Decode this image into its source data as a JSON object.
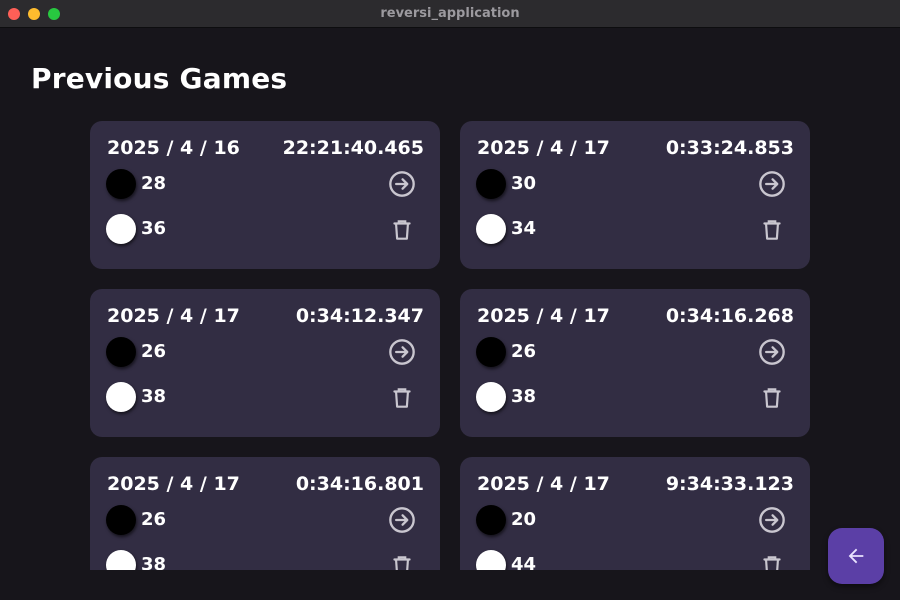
{
  "window": {
    "title": "reversi_application",
    "colors": {
      "background": "#17151b",
      "titlebar": "#2c2b2e"
    }
  },
  "page": {
    "title": "Previous Games"
  },
  "colors": {
    "card_bg": "#322d43",
    "icon": "#c9c6cf",
    "fab_bg": "#5b3fa6",
    "fab_icon": "#e9e3ff",
    "text": "#ffffff"
  },
  "games": [
    {
      "date": "2025 / 4 / 16",
      "time": "22:21:40.465",
      "black_score": "28",
      "white_score": "36",
      "open_icon": "arrow-circle-right-icon",
      "delete_icon": "trash-icon"
    },
    {
      "date": "2025 / 4 / 17",
      "time": "0:33:24.853",
      "black_score": "30",
      "white_score": "34",
      "open_icon": "arrow-circle-right-icon",
      "delete_icon": "trash-icon"
    },
    {
      "date": "2025 / 4 / 17",
      "time": "0:34:12.347",
      "black_score": "26",
      "white_score": "38",
      "open_icon": "arrow-circle-right-icon",
      "delete_icon": "trash-icon"
    },
    {
      "date": "2025 / 4 / 17",
      "time": "0:34:16.268",
      "black_score": "26",
      "white_score": "38",
      "open_icon": "arrow-circle-right-icon",
      "delete_icon": "trash-icon"
    },
    {
      "date": "2025 / 4 / 17",
      "time": "0:34:16.801",
      "black_score": "26",
      "white_score": "38",
      "open_icon": "arrow-circle-right-icon",
      "delete_icon": "trash-icon"
    },
    {
      "date": "2025 / 4 / 17",
      "time": "9:34:33.123",
      "black_score": "20",
      "white_score": "44",
      "open_icon": "arrow-circle-right-icon",
      "delete_icon": "trash-icon"
    }
  ],
  "fab": {
    "icon": "arrow-left-icon"
  }
}
